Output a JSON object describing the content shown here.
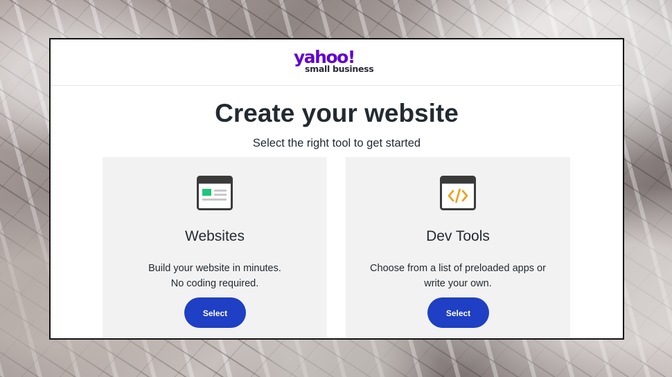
{
  "brand": {
    "wordmark": "yahoo!",
    "subtitle": "small business",
    "color": "#6001d2"
  },
  "page": {
    "title": "Create your website",
    "subtitle": "Select the right tool to get started"
  },
  "cards": [
    {
      "icon": "website-layout-icon",
      "title": "Websites",
      "description_lines": [
        "Build your website in minutes.",
        "No coding required."
      ],
      "button_label": "Select"
    },
    {
      "icon": "code-brackets-icon",
      "title": "Dev Tools",
      "description_lines": [
        "Choose from a list of preloaded apps or",
        "write your own."
      ],
      "button_label": "Select"
    }
  ],
  "colors": {
    "button": "#1f3fc4",
    "card_background": "#f2f2f2",
    "icon_accent_green": "#1fc67b",
    "icon_accent_orange": "#f39c12"
  }
}
